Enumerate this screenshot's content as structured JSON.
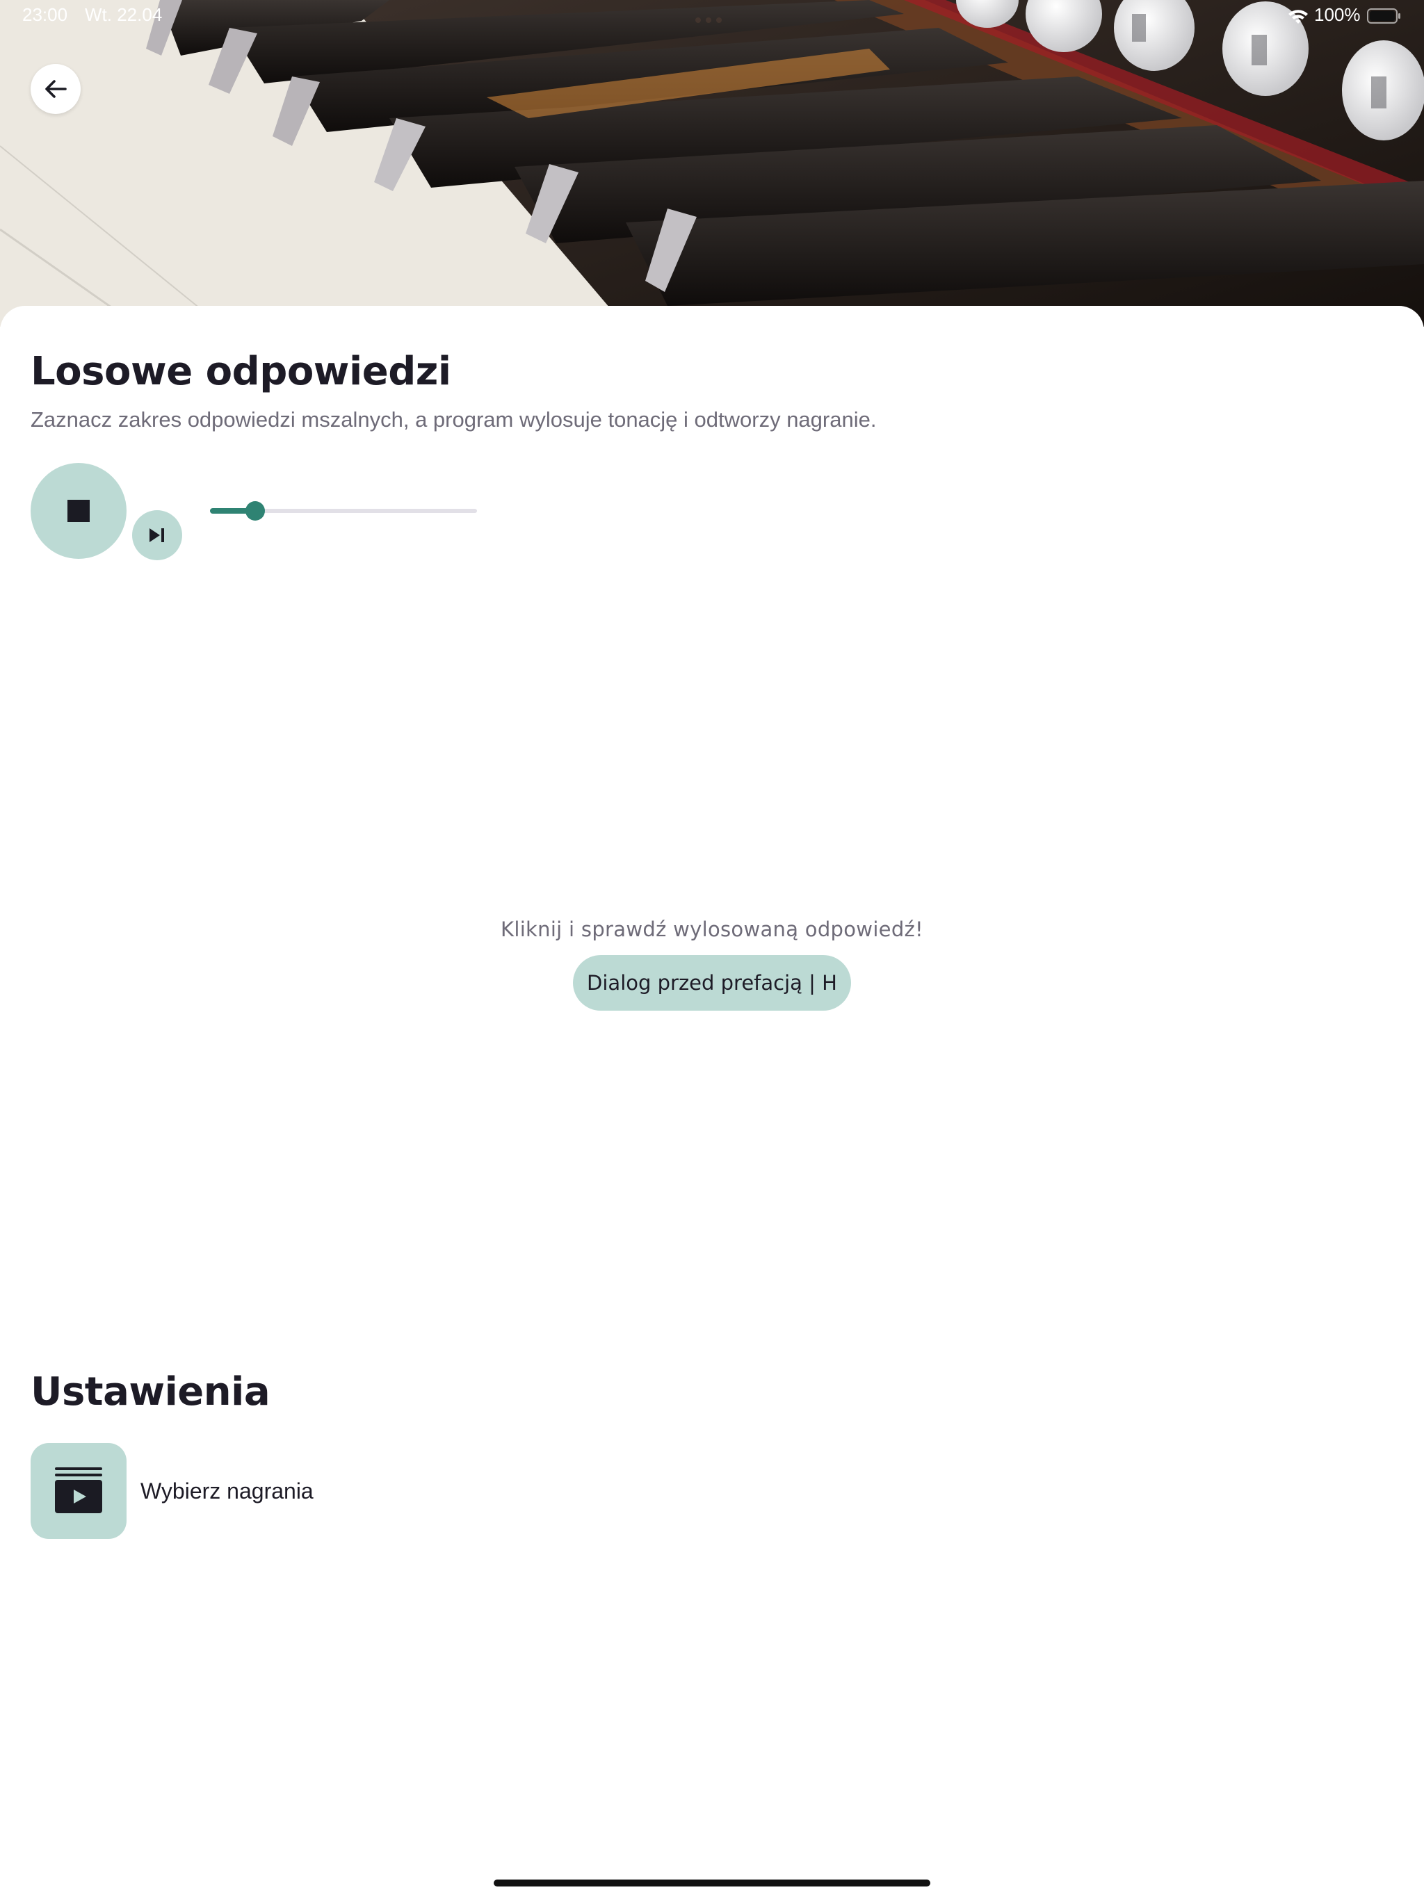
{
  "status_bar": {
    "time": "23:00",
    "date": "Wt. 22.04",
    "battery": "100%",
    "icons": [
      "wifi-icon",
      "battery-icon"
    ]
  },
  "header": {
    "image": "organ-keyboard-photo",
    "back_icon": "arrow-left-icon"
  },
  "content": {
    "title": "Losowe odpowiedzi",
    "subtitle": "Zaznacz zakres odpowiedzi mszalnych, a program wylosuje tonację i odtworzy nagranie."
  },
  "player": {
    "stop_icon": "stop-icon",
    "next_icon": "skip-next-icon",
    "progress": 0.17
  },
  "answer": {
    "prompt": "Kliknij i sprawdź wylosowaną odpowiedź!",
    "chip_label": "Dialog przed prefacją | H"
  },
  "settings": {
    "title": "Ustawienia",
    "items": [
      {
        "label": "Wybierz nagrania",
        "icon": "playlist-play-icon"
      }
    ]
  },
  "colors": {
    "accent": "#2f8373",
    "accent_light": "#bcdad4",
    "text_dark": "#1d1b26",
    "text_muted": "#6e6b78"
  }
}
